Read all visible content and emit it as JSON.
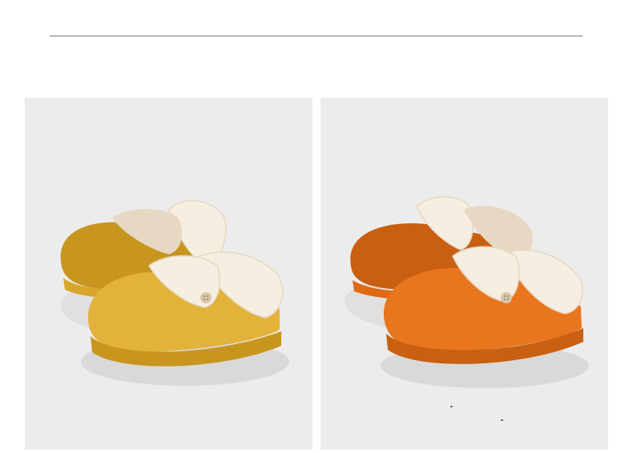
{
  "page": {
    "background": "#ffffff",
    "rule_color": "#b9b9b9",
    "panel_background": "#ececec"
  },
  "products": [
    {
      "id": "yellow",
      "colors": {
        "shell": "#e3b23a",
        "shell_shade": "#c8951f",
        "shell_light": "#efcb6a",
        "sole": "#d9a52c",
        "fur": "#f6eee0",
        "fur_shade": "#e6d8c2",
        "button": "#d8c8aa"
      }
    },
    {
      "id": "orange",
      "colors": {
        "shell": "#e8761e",
        "shell_shade": "#c95f10",
        "shell_light": "#f29a4e",
        "sole": "#de6a14",
        "fur": "#f6eee0",
        "fur_shade": "#e6d8c2",
        "button": "#d8c8aa"
      }
    }
  ]
}
